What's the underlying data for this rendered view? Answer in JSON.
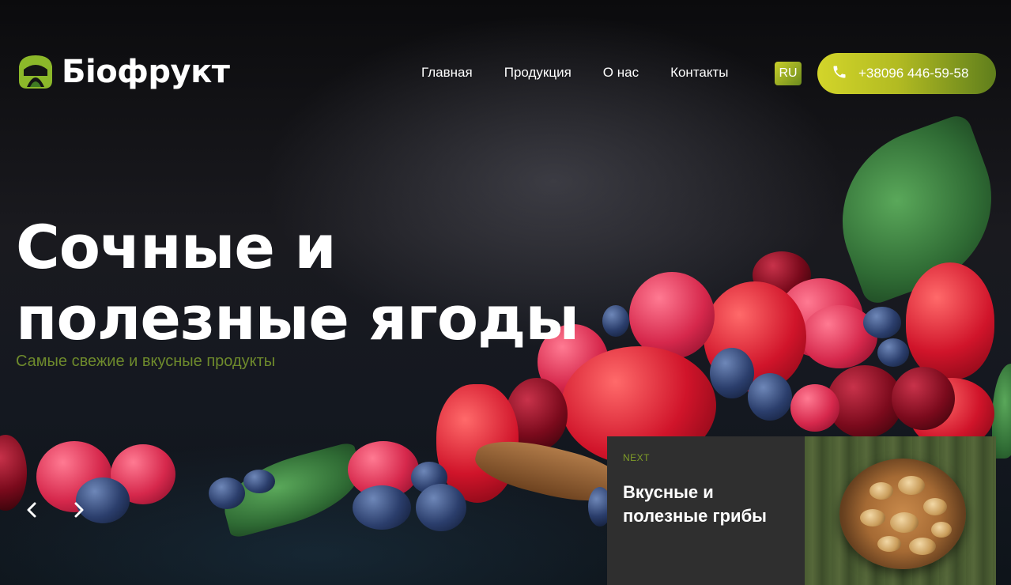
{
  "brand": {
    "name": "Біофрукт",
    "accent_color": "#a8b422",
    "logo_colors": [
      "#8cb82a",
      "#3f7a22"
    ]
  },
  "nav": {
    "items": [
      {
        "label": "Главная"
      },
      {
        "label": "Продукция"
      },
      {
        "label": "О нас"
      },
      {
        "label": "Контакты"
      }
    ],
    "language": "RU"
  },
  "contact": {
    "phone": "+38096 446-59-58",
    "icon": "phone-icon"
  },
  "hero": {
    "title_line1": "Сочные и",
    "title_line2": "полезные ягоды",
    "subtitle": "Самые свежие и вкусные продукты",
    "subtitle_color": "#6e8a2c"
  },
  "slider": {
    "prev_icon": "chevron-left-icon",
    "next_icon": "chevron-right-icon",
    "next_card": {
      "label": "NEXT",
      "title": "Вкусные и полезные грибы"
    }
  }
}
